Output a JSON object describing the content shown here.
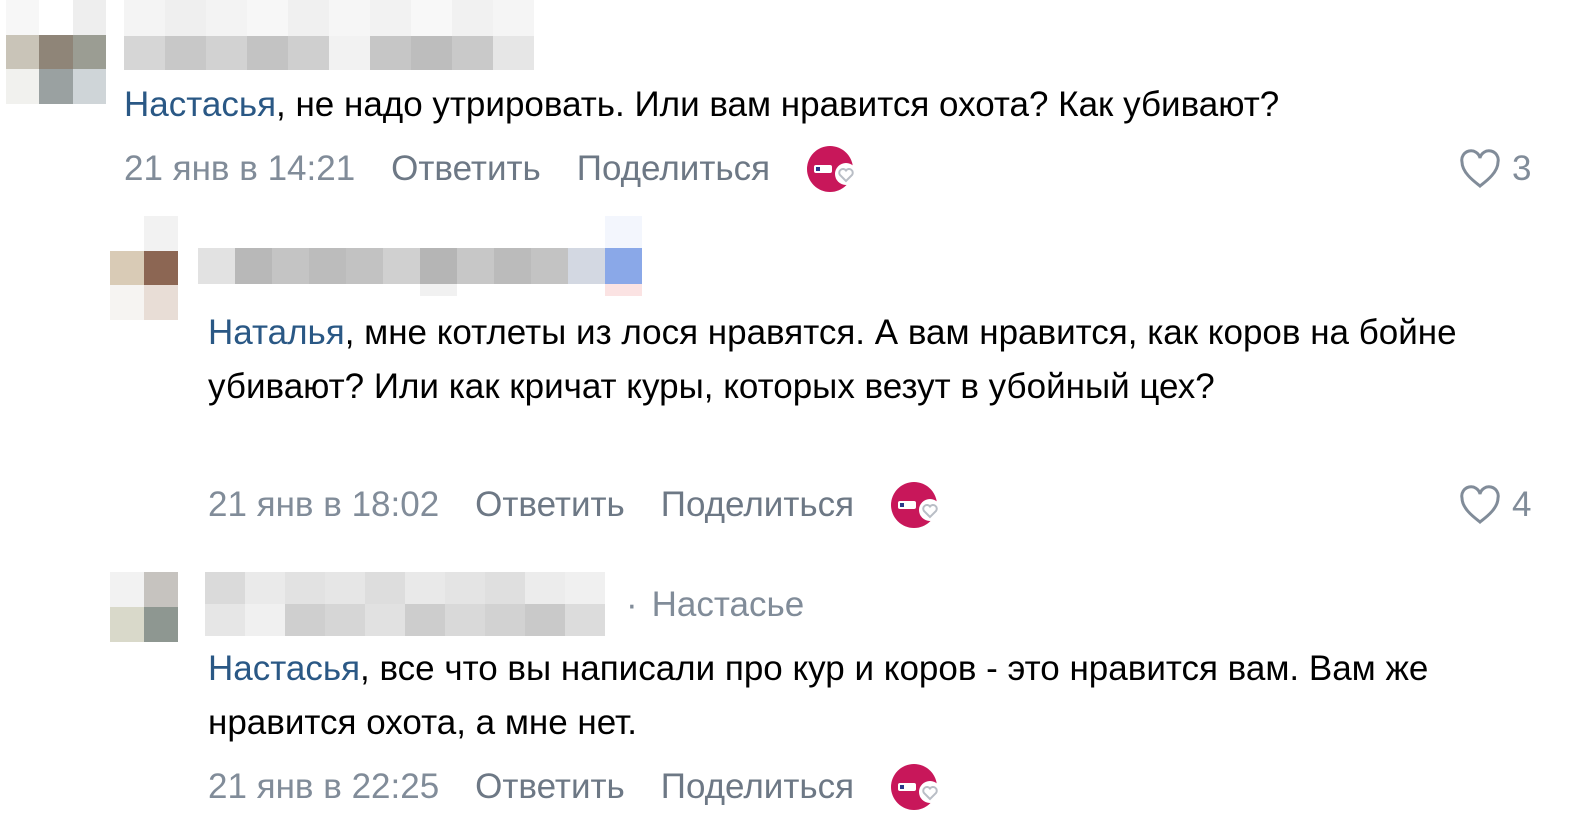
{
  "comments": [
    {
      "mention": "Настасья",
      "body": ", не надо утрировать. Или вам нравится охота? Как убивают?",
      "date": "21 янв в 14:21",
      "reply_label": "Ответить",
      "share_label": "Поделиться",
      "likes": "3"
    },
    {
      "mention": "Наталья",
      "body": ", мне котлеты из лося нравятся. А вам нравится, как коров на бойне убивают? Или как кричат куры, которых везут в убойный цех?",
      "date": "21 янв в 18:02",
      "reply_label": "Ответить",
      "share_label": "Поделиться",
      "likes": "4"
    },
    {
      "reply_to": "Настасье",
      "mention": "Настасья",
      "body": ", все что вы написали про кур и коров - это нравится вам. Вам же нравится охота, а мне нет.",
      "date": "21 янв в 22:25",
      "reply_label": "Ответить",
      "share_label": "Поделиться"
    }
  ],
  "icons": {
    "reaction": "reaction-badge-icon",
    "like": "heart-outline-icon"
  },
  "colors": {
    "mention": "#2a5885",
    "meta": "#818c99",
    "action": "#6d7885",
    "reaction_badge": "#c8175a"
  }
}
